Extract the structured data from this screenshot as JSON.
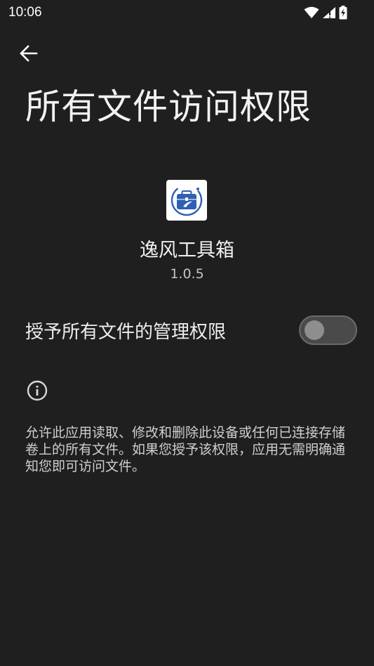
{
  "status_bar": {
    "time": "10:06",
    "icons": [
      "wifi-icon",
      "signal-icon",
      "battery-charging-icon"
    ]
  },
  "header": {
    "back_icon": "arrow-back-icon",
    "title": "所有文件访问权限"
  },
  "app": {
    "icon": "toolbox-app-icon",
    "name": "逸风工具箱",
    "version": "1.0.5"
  },
  "permission": {
    "label": "授予所有文件的管理权限",
    "enabled": false
  },
  "info": {
    "icon": "info-icon",
    "description": "允许此应用读取、修改和删除此设备或任何已连接存储卷上的所有文件。如果您授予该权限，应用无需明确通知您即可访问文件。"
  },
  "colors": {
    "background": "#1f1f1f",
    "text_primary": "#eeeeee",
    "text_secondary": "#cfcfcf",
    "toggle_track": "#4a4a4a",
    "toggle_thumb": "#8e8e8e",
    "app_icon_blue": "#2f5fb3"
  }
}
